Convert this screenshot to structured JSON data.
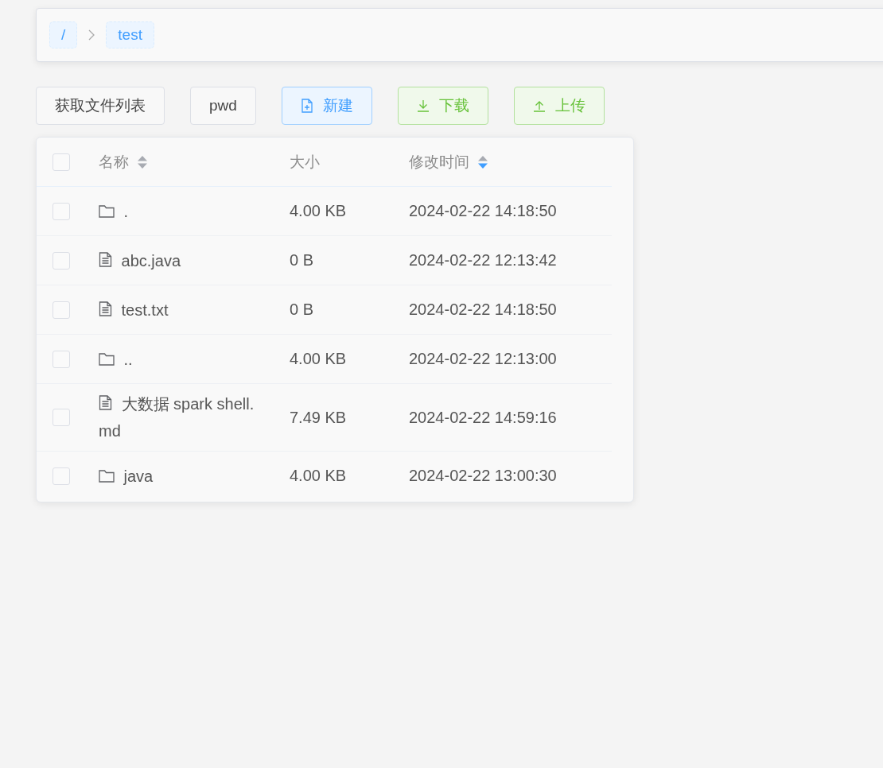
{
  "breadcrumb": [
    {
      "label": "/"
    },
    {
      "label": "test"
    }
  ],
  "toolbar": [
    {
      "label": "获取文件列表",
      "kind": "default"
    },
    {
      "label": "pwd",
      "kind": "default"
    },
    {
      "label": "新建",
      "kind": "new"
    },
    {
      "label": "下载",
      "kind": "download"
    },
    {
      "label": "上传",
      "kind": "upload"
    }
  ],
  "table": {
    "all_checked": false,
    "columns": [
      {
        "label": "名称",
        "sorted_descending": false
      },
      {
        "label": "大小"
      },
      {
        "label": "修改时间",
        "sorted_descending": true
      }
    ],
    "rows": [
      {
        "checked": false,
        "kind": "folder",
        "name": ".",
        "size": "4.00 KB",
        "modified": "2024-02-22 14:18:50"
      },
      {
        "checked": false,
        "kind": "file",
        "name": "abc.java",
        "size": "0 B",
        "modified": "2024-02-22 12:13:42"
      },
      {
        "checked": false,
        "kind": "file",
        "name": "test.txt",
        "size": "0 B",
        "modified": "2024-02-22 14:18:50"
      },
      {
        "checked": false,
        "kind": "folder",
        "name": "..",
        "size": "4.00 KB",
        "modified": "2024-02-22 12:13:00"
      },
      {
        "checked": false,
        "kind": "file",
        "name": "大数据 spark shell.md",
        "size": "7.49 KB",
        "modified": "2024-02-22 14:59:16"
      },
      {
        "checked": false,
        "kind": "folder",
        "name": "java",
        "size": "4.00 KB",
        "modified": "2024-02-22 13:00:30"
      }
    ]
  }
}
